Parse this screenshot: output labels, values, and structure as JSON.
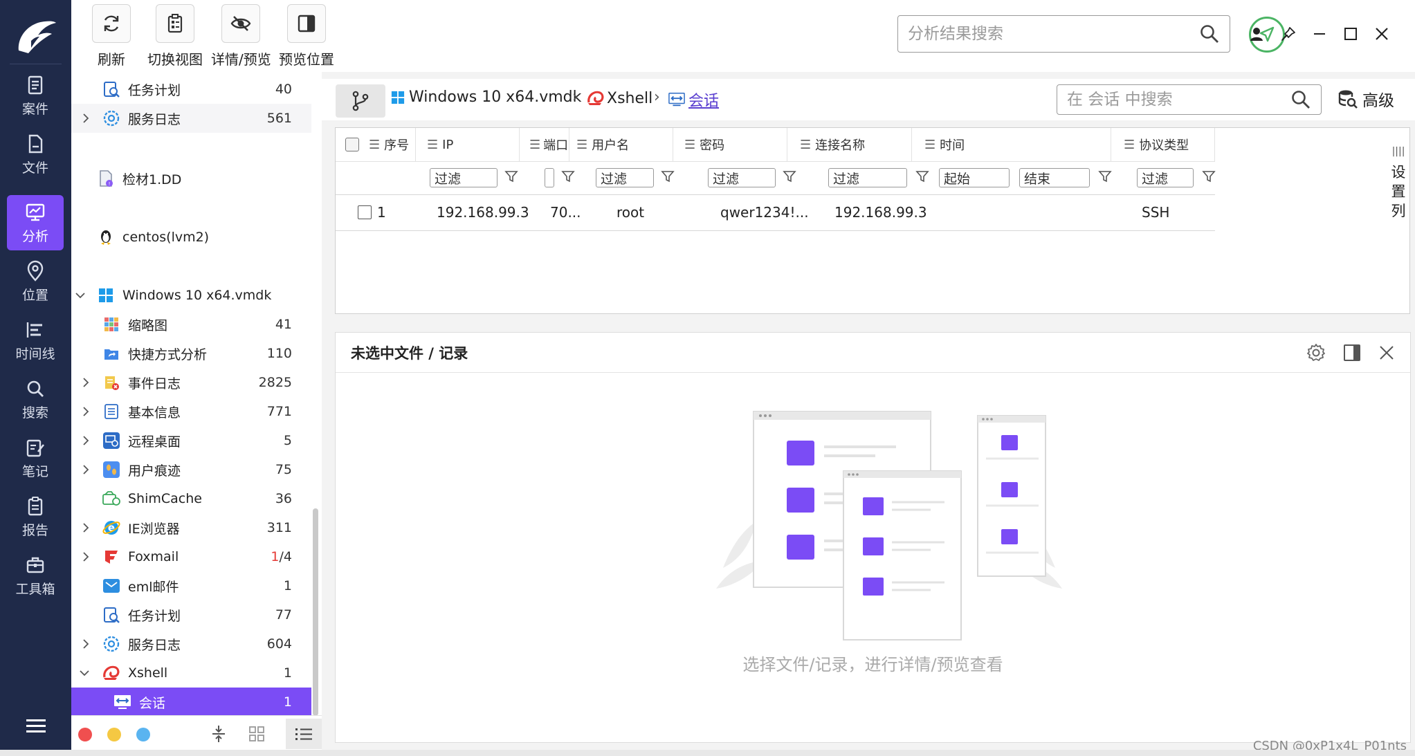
{
  "nav": {
    "items": [
      {
        "label": "案件",
        "icon": "case-icon"
      },
      {
        "label": "文件",
        "icon": "file-icon"
      },
      {
        "label": "分析",
        "icon": "analysis-icon",
        "active": true
      },
      {
        "label": "位置",
        "icon": "location-icon"
      },
      {
        "label": "时间线",
        "icon": "timeline-icon"
      },
      {
        "label": "搜索",
        "icon": "search-icon"
      },
      {
        "label": "笔记",
        "icon": "note-icon"
      },
      {
        "label": "报告",
        "icon": "report-icon"
      },
      {
        "label": "工具箱",
        "icon": "toolbox-icon"
      }
    ]
  },
  "toolbar": {
    "refresh": "刷新",
    "switch_view": "切换视图",
    "detail_preview": "详情/预览",
    "preview_position": "预览位置",
    "search_placeholder": "分析结果搜索"
  },
  "tree": {
    "rows": [
      {
        "label": "任务计划",
        "count": "40"
      },
      {
        "label": "服务日志",
        "count": "561"
      },
      {
        "label": "检材1.DD",
        "count": ""
      },
      {
        "label": "centos(lvm2)",
        "count": ""
      },
      {
        "label": "Windows 10 x64.vmdk",
        "count": ""
      },
      {
        "label": "缩略图",
        "count": "41"
      },
      {
        "label": "快捷方式分析",
        "count": "110"
      },
      {
        "label": "事件日志",
        "count": "2825"
      },
      {
        "label": "基本信息",
        "count": "771"
      },
      {
        "label": "远程桌面",
        "count": "5"
      },
      {
        "label": "用户痕迹",
        "count": "75"
      },
      {
        "label": "ShimCache",
        "count": "36"
      },
      {
        "label": "IE浏览器",
        "count": "311"
      },
      {
        "label": "Foxmail",
        "count_red": "1",
        "count": "/4"
      },
      {
        "label": "eml邮件",
        "count": "1"
      },
      {
        "label": "任务计划",
        "count": "77"
      },
      {
        "label": "服务日志",
        "count": "604"
      },
      {
        "label": "Xshell",
        "count": "1"
      },
      {
        "label": "会话",
        "count": "1"
      }
    ]
  },
  "breadcrumb": {
    "items": [
      "Windows 10 x64.vmdk",
      "Xshell",
      "会话"
    ],
    "search_placeholder": "在 会话 中搜索",
    "advanced": "高级"
  },
  "grid": {
    "headers": [
      "序号",
      "IP",
      "端口",
      "用户名",
      "密码",
      "连接名称",
      "时间",
      "协议类型"
    ],
    "filter_placeholder": "过滤",
    "time_start": "起始",
    "time_end": "结束",
    "rows": [
      {
        "index": "1",
        "ip": "192.168.99.3",
        "port": "70...",
        "username": "root",
        "password": "qwer1234!...",
        "conn_name": "192.168.99.3",
        "time": "",
        "protocol": "SSH"
      }
    ],
    "column_settings": [
      "设",
      "置",
      "列"
    ]
  },
  "preview": {
    "title": "未选中文件 / 记录",
    "hint": "选择文件/记录，进行详情/预览查看"
  },
  "watermark": "CSDN @0xP1x4L_P01nts"
}
